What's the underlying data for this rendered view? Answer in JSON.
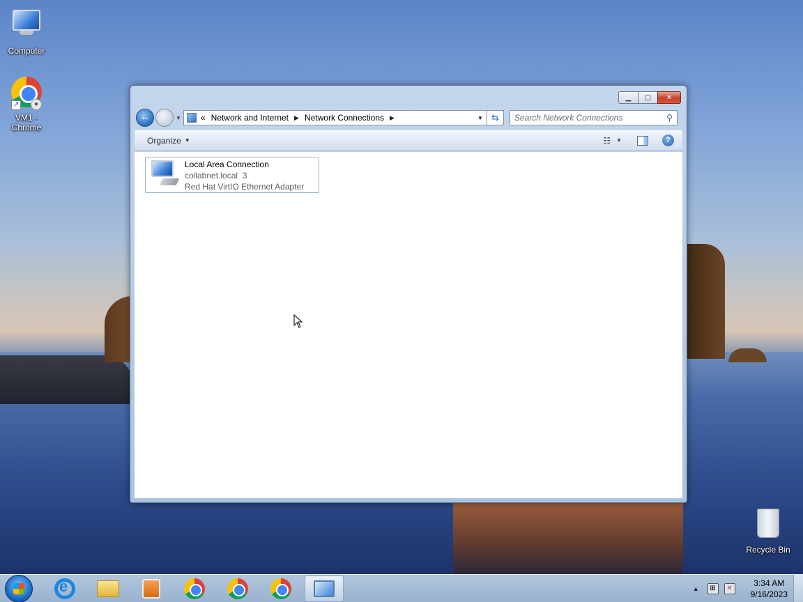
{
  "desktop": {
    "icons": [
      {
        "label": "Computer",
        "icon": "computer-icon"
      },
      {
        "label": "VM1 - Chrome",
        "icon": "chrome-icon"
      },
      {
        "label": "Recycle Bin",
        "icon": "recycle-bin-icon"
      }
    ]
  },
  "window": {
    "address": {
      "chevrons": "«",
      "breadcrumbs": [
        "Network and Internet",
        "Network Connections"
      ]
    },
    "search": {
      "placeholder": "Search Network Connections"
    },
    "toolbar": {
      "organize_label": "Organize"
    },
    "connections": [
      {
        "name": "Local Area Connection",
        "network": "collabnet.local  3",
        "adapter": "Red Hat VirtIO Ethernet Adapter"
      }
    ]
  },
  "taskbar": {
    "items": [
      "start",
      "internet-explorer",
      "windows-explorer",
      "media-player",
      "chrome",
      "chrome-profile",
      "chrome",
      "network-connections"
    ],
    "clock": {
      "time": "3:34 AM",
      "date": "9/16/2023"
    }
  },
  "colors": {
    "window_frame": "#b5cbe4",
    "accent": "#2e6cc0",
    "close_button": "#c7412b"
  }
}
